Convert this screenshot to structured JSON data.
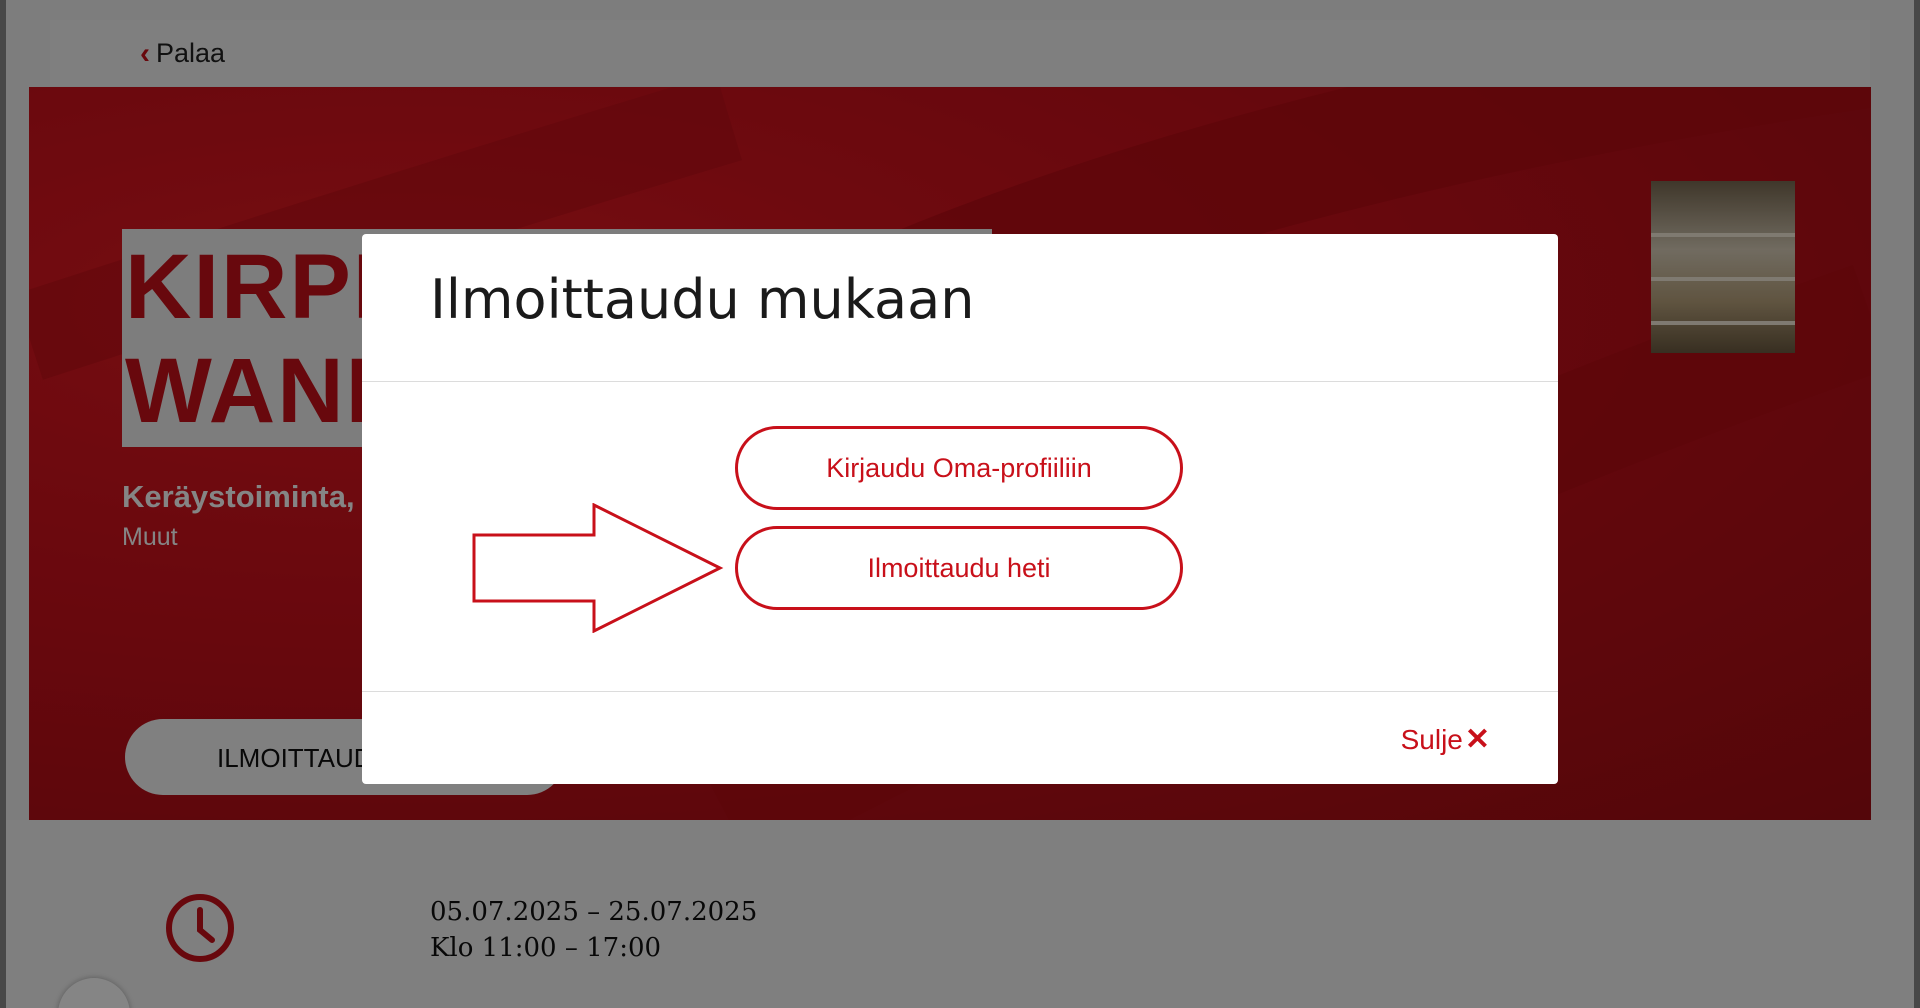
{
  "nav": {
    "back_label": "Palaa"
  },
  "hero": {
    "title_line1": "KIRPPIS",
    "title_line2": "WANHA",
    "subtitle": "Keräystoiminta, M",
    "category": "Muut",
    "cta_label": "ILMOITTAUDU"
  },
  "event": {
    "date_range": "05.07.2025 – 25.07.2025",
    "time_range": "Klo 11:00 – 17:00"
  },
  "modal": {
    "title": "Ilmoittaudu mukaan",
    "login_button": "Kirjaudu Oma-profiiliin",
    "register_button": "Ilmoittaudu heti",
    "close_label": "Sulje"
  },
  "colors": {
    "accent": "#c8101a",
    "overlay": "rgba(0,0,0,0.48)"
  },
  "icons": {
    "back": "chevron-left-icon",
    "clock": "clock-icon",
    "close": "close-icon",
    "arrow": "arrow-right-icon"
  }
}
